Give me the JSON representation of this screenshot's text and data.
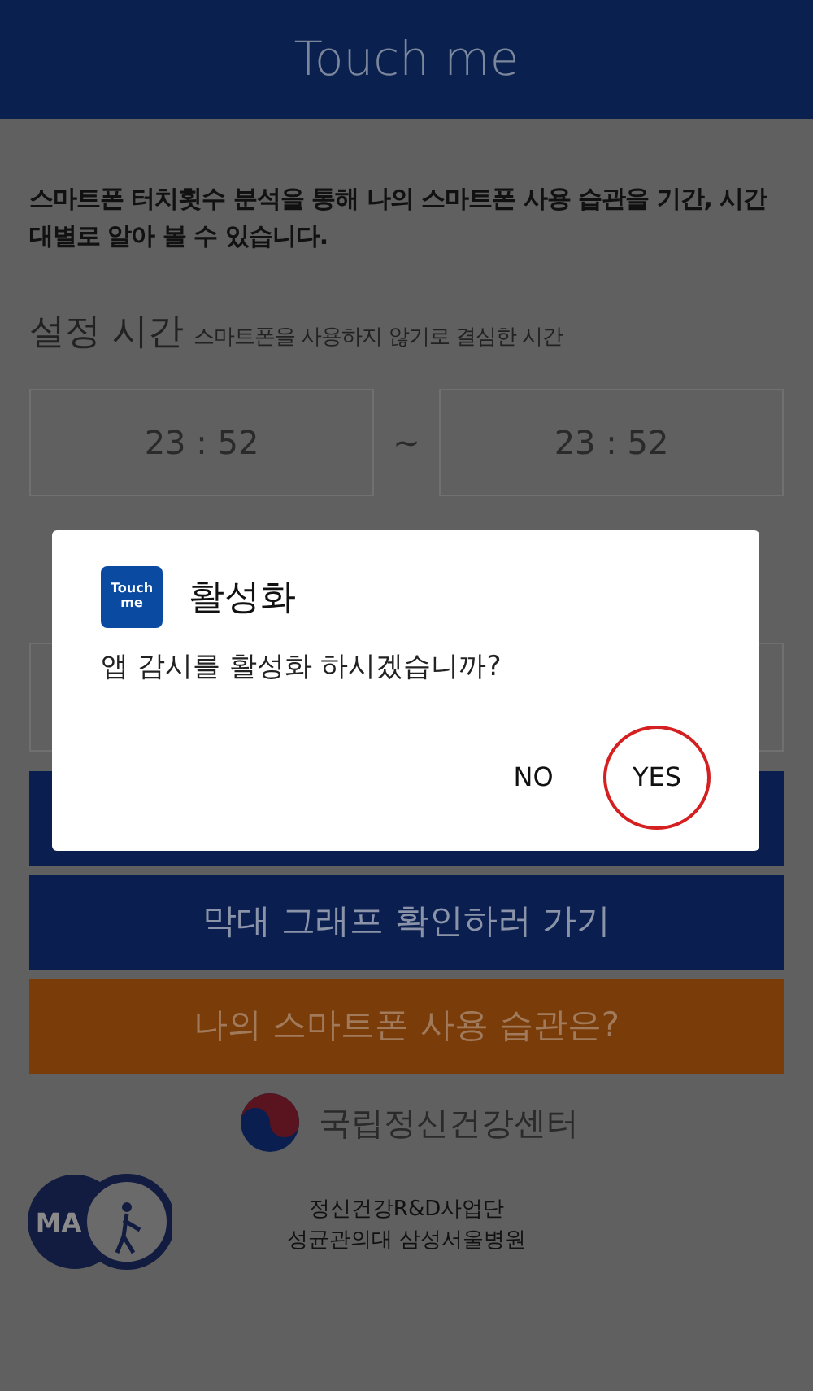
{
  "app_bar": {
    "title": "Touch me"
  },
  "intro": "스마트폰 터치횟수 분석을 통해 나의 스마트폰 사용 습관을 기간, 시간대별로 알아 볼 수 있습니다.",
  "setting": {
    "title": "설정 시간",
    "subtitle": "스마트폰을 사용하지 않기로 결심한 시간",
    "start": "23 : 52",
    "separator": "~",
    "end": "23 : 52"
  },
  "buttons": [
    {
      "color": "#0a1f4f"
    },
    {
      "label": "막대 그래프 확인하러 가기",
      "color": "#0a1f4f"
    },
    {
      "label": "나의 스마트폰 사용 습관은?",
      "color": "#7a3d0a"
    }
  ],
  "footer": {
    "org": "국립정신건강센터",
    "badge": "MA",
    "lines": [
      "정신건강R&D사업단",
      "성균관의대 삼성서울병원"
    ]
  },
  "dialog": {
    "icon_text": [
      "Touch",
      "me"
    ],
    "title": "활성화",
    "message": "앱 감시를 활성화 하시겠습니까?",
    "actions": [
      {
        "label": "NO",
        "highlighted": false
      },
      {
        "label": "YES",
        "highlighted": true
      }
    ]
  }
}
